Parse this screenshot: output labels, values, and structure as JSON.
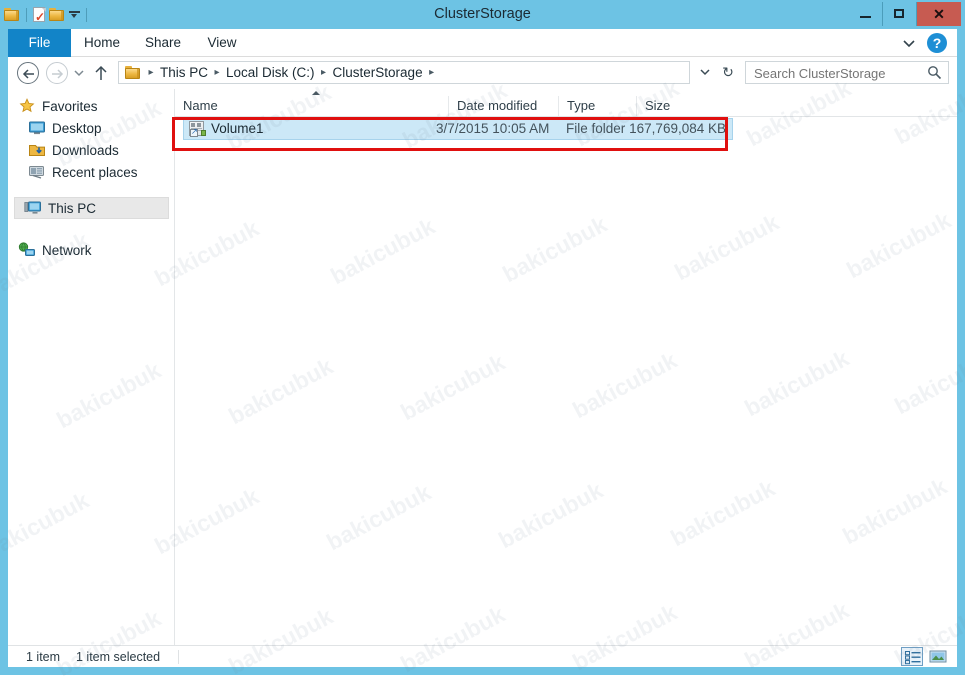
{
  "window": {
    "title": "ClusterStorage",
    "controls": {
      "minimize": "minimize",
      "maximize": "maximize",
      "close": "✕"
    },
    "frame_color": "#6dc3e4",
    "close_color": "#c75b51"
  },
  "quick_access": {
    "items": [
      {
        "name": "folder-icon",
        "label": ""
      },
      {
        "name": "properties-icon",
        "label": ""
      },
      {
        "name": "new-folder-icon",
        "label": ""
      },
      {
        "name": "customize-caret-icon",
        "label": ""
      }
    ]
  },
  "ribbon": {
    "accent_color": "#1284c8",
    "tabs": [
      {
        "label": "File",
        "selected": true
      },
      {
        "label": "Home",
        "selected": false
      },
      {
        "label": "Share",
        "selected": false
      },
      {
        "label": "View",
        "selected": false
      }
    ],
    "expand_icon": "chevron-down-icon",
    "help_label": "?"
  },
  "addressbar": {
    "back": "←",
    "forward": "→",
    "recent_caret": "▾",
    "up": "↑",
    "breadcrumbs": [
      "This PC",
      "Local Disk (C:)",
      "ClusterStorage"
    ],
    "separator": "▸",
    "dropdown_caret": "▾",
    "refresh": "↻"
  },
  "search": {
    "placeholder": "Search ClusterStorage",
    "value": "",
    "icon": "search-icon"
  },
  "sidebar": {
    "items": [
      {
        "label": "Favorites",
        "icon": "star-icon",
        "level": 0,
        "selected": false
      },
      {
        "label": "Desktop",
        "icon": "desktop-icon",
        "level": 1,
        "selected": false
      },
      {
        "label": "Downloads",
        "icon": "downloads-icon",
        "level": 1,
        "selected": false
      },
      {
        "label": "Recent places",
        "icon": "recent-places-icon",
        "level": 1,
        "selected": false
      },
      {
        "label": "This PC",
        "icon": "this-pc-icon",
        "level": 0,
        "selected": true
      },
      {
        "label": "Network",
        "icon": "network-icon",
        "level": 0,
        "selected": false
      }
    ]
  },
  "filelist": {
    "columns": [
      {
        "label": "Name",
        "sorted": "asc"
      },
      {
        "label": "Date modified",
        "sorted": ""
      },
      {
        "label": "Type",
        "sorted": ""
      },
      {
        "label": "Size",
        "sorted": ""
      }
    ],
    "rows": [
      {
        "name": "Volume1",
        "date_modified": "3/7/2015 10:05 AM",
        "type": "File folder",
        "size": "167,769,084 KB",
        "icon": "junction-shortcut-icon",
        "selected": true
      }
    ],
    "selection_color": "#cce8f7",
    "annotation_color": "#e0100f"
  },
  "statusbar": {
    "item_count": "1 item",
    "selection_info": "1 item selected",
    "view_buttons": [
      {
        "name": "details-view-button",
        "active": true
      },
      {
        "name": "large-icons-view-button",
        "active": false
      }
    ]
  },
  "watermark": {
    "text": "bakicubuk"
  }
}
